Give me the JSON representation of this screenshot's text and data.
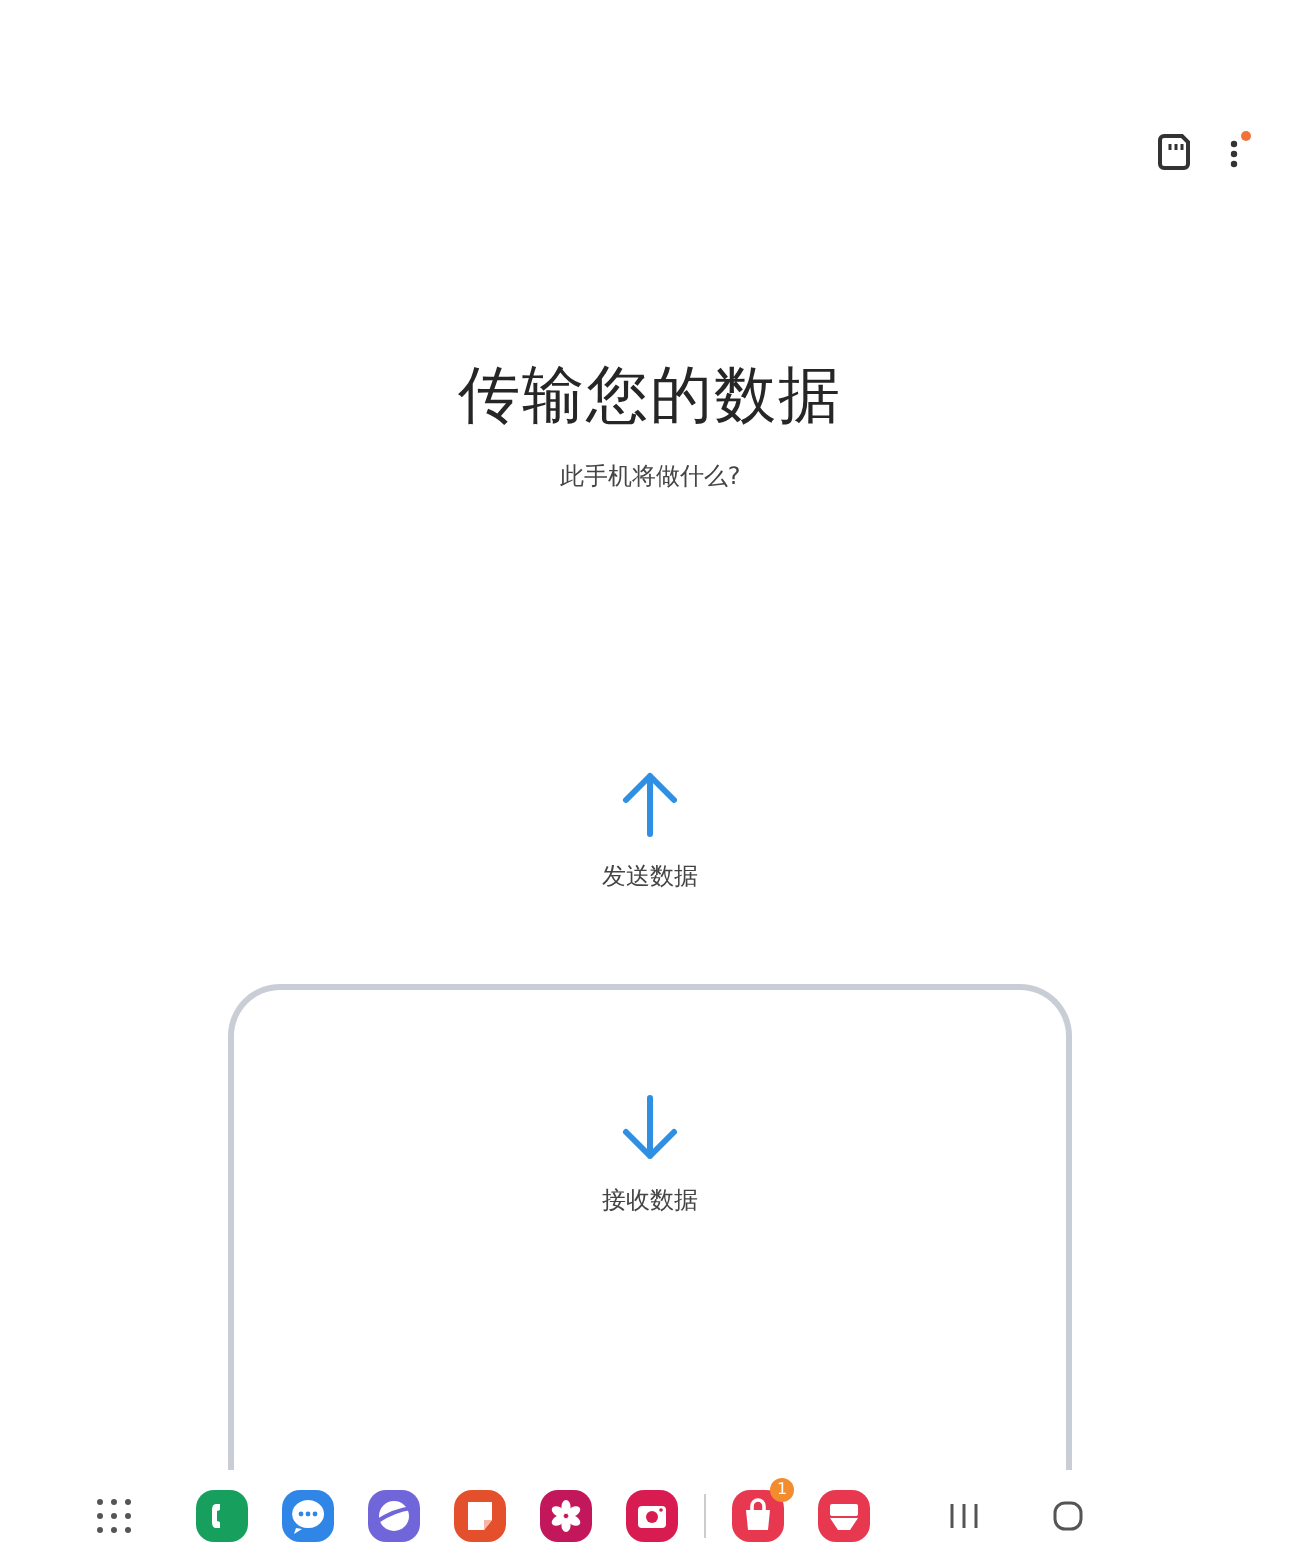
{
  "top_bar": {
    "has_update": true
  },
  "title": "传输您的数据",
  "subtitle": "此手机将做什么?",
  "options": [
    {
      "kind": "send",
      "label": "发送数据",
      "selected": false
    },
    {
      "kind": "receive",
      "label": "接收数据",
      "selected": true
    }
  ],
  "taskbar": {
    "apps": [
      {
        "kind": "phone",
        "color": "#17a05d"
      },
      {
        "kind": "messages",
        "color": "#2f86e6"
      },
      {
        "kind": "browser",
        "color": "#7166d9"
      },
      {
        "kind": "notes",
        "color": "#e5502c"
      },
      {
        "kind": "flower",
        "color": "#c2185b"
      },
      {
        "kind": "camera",
        "color": "#d81b50"
      }
    ],
    "recent_apps": [
      {
        "kind": "store",
        "color": "#e8384f",
        "badge": "1"
      },
      {
        "kind": "tray",
        "color": "#e8384f"
      }
    ]
  }
}
